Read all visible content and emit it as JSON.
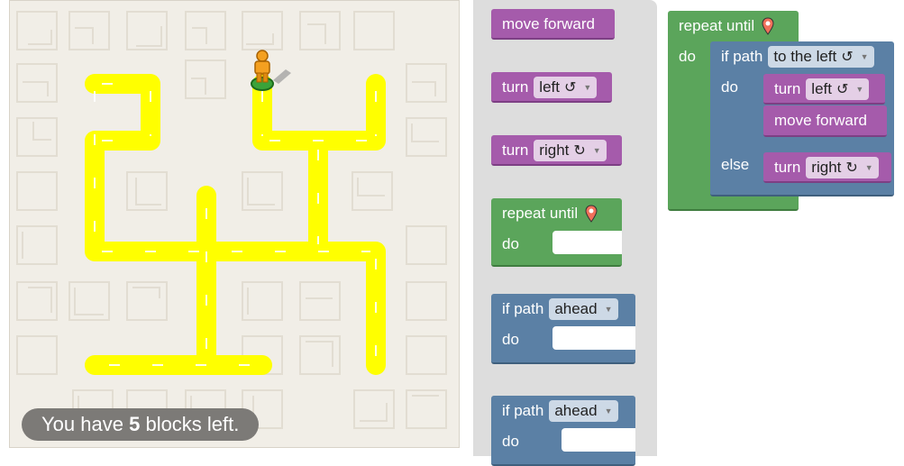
{
  "status": {
    "prefix": "You have",
    "count": "5",
    "suffix": "blocks left."
  },
  "toolbox": {
    "move_forward": "move forward",
    "turn_left": {
      "label": "turn",
      "option": "left",
      "glyph": "↺"
    },
    "turn_right": {
      "label": "turn",
      "option": "right",
      "glyph": "↻"
    },
    "repeat_until": {
      "label": "repeat until",
      "do": "do"
    },
    "if_path_1": {
      "label": "if path",
      "option": "ahead",
      "do": "do"
    },
    "if_path_2": {
      "label": "if path",
      "option": "ahead",
      "do": "do"
    }
  },
  "workspace": {
    "repeat_until": {
      "label": "repeat until",
      "do": "do"
    },
    "if_else": {
      "label": "if path",
      "option": "to the left",
      "glyph": "↺",
      "do": "do",
      "else": "else"
    },
    "turn_left": {
      "label": "turn",
      "option": "left",
      "glyph": "↺"
    },
    "move_forward": "move forward",
    "turn_right": {
      "label": "turn",
      "option": "right",
      "glyph": "↻"
    }
  },
  "colors": {
    "path": "#ffff00",
    "maze_bg": "#f1eee7",
    "action_block": "#a55bab",
    "loop_block": "#5ba55b",
    "logic_block": "#5b80a5",
    "toolbox_bg": "#dddddd"
  },
  "icons": [
    "pegman-icon",
    "marker-icon",
    "dropdown-arrow-icon"
  ]
}
